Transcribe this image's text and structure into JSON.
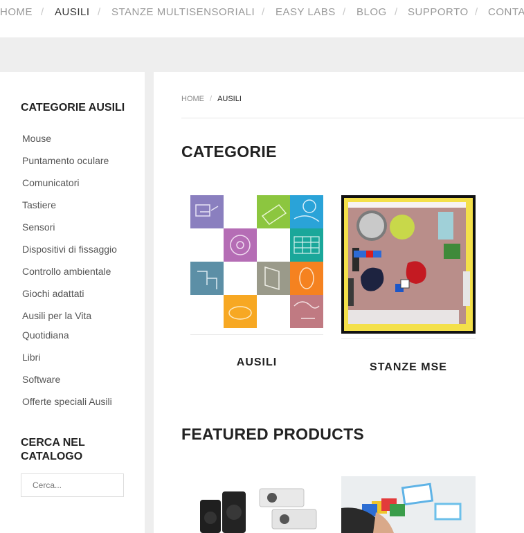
{
  "nav": {
    "items": [
      {
        "label": "HOME",
        "active": false
      },
      {
        "label": "AUSILI",
        "active": true
      },
      {
        "label": "STANZE MULTISENSORIALI",
        "active": false
      },
      {
        "label": "EASY LABS",
        "active": false
      },
      {
        "label": "BLOG",
        "active": false
      },
      {
        "label": "SUPPORTO",
        "active": false
      },
      {
        "label": "CONTA",
        "active": false
      }
    ],
    "separator": "/"
  },
  "sidebar": {
    "categories_title": "CATEGORIE AUSILI",
    "categories": [
      "Mouse",
      "Puntamento oculare",
      "Comunicatori",
      "Tastiere",
      "Sensori",
      "Dispositivi di fissaggio",
      "Controllo ambientale",
      "Giochi adattati",
      "Ausili per la Vita Quotidiana",
      "Libri",
      "Software",
      "Offerte speciali Ausili"
    ],
    "search_title_line1": "CERCA NEL",
    "search_title_line2": "CATALOGO",
    "search_placeholder": "Cerca..."
  },
  "breadcrumb": {
    "home": "HOME",
    "separator": "/",
    "current": "AUSILI"
  },
  "main": {
    "categories_heading": "CATEGORIE",
    "category_cards": [
      {
        "label": "AUSILI",
        "image": "ausili-icon-mosaic"
      },
      {
        "label": "STANZE MSE",
        "image": "multisensory-room-topview"
      }
    ],
    "featured_heading": "FEATURED PRODUCTS",
    "featured_products": [
      {
        "image": "speakers-and-projectors"
      },
      {
        "image": "hand-on-colored-cards"
      }
    ]
  },
  "colors": {
    "gray_bar": "#eeeeee",
    "active_nav": "#333333",
    "inactive_nav": "#999999"
  }
}
